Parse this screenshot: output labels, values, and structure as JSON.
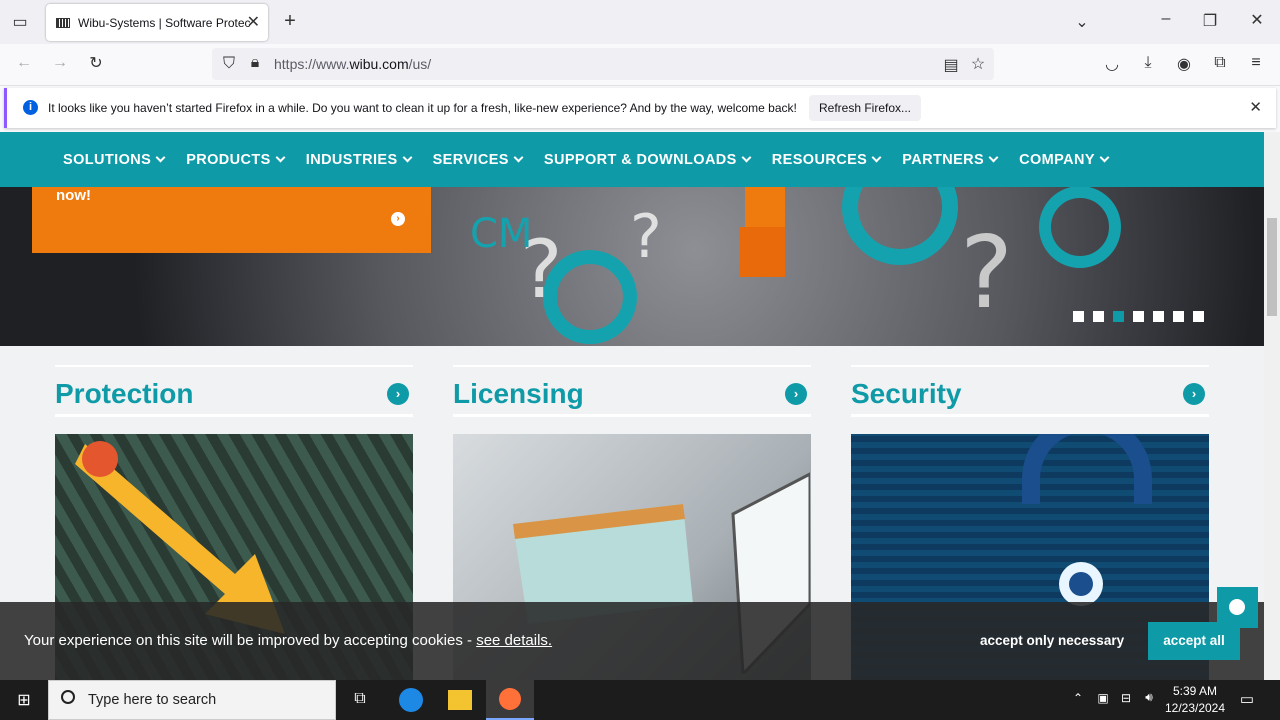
{
  "browser": {
    "tab_title": "Wibu-Systems | Software Protec",
    "url_prefix": "https://www.",
    "url_domain": "wibu.com",
    "url_path": "/us/",
    "notification": "It looks like you haven’t started Firefox in a while. Do you want to clean it up for a fresh, like-new experience? And by the way, welcome back!",
    "refresh_label": "Refresh Firefox..."
  },
  "site": {
    "nav": [
      "SOLUTIONS",
      "PRODUCTS",
      "INDUSTRIES",
      "SERVICES",
      "SUPPORT & DOWNLOADS",
      "RESOURCES",
      "PARTNERS",
      "COMPANY"
    ],
    "hero_text": "now!",
    "slider_active_index": 2,
    "slider_count": 7,
    "cards": [
      {
        "title": "Protection"
      },
      {
        "title": "Licensing"
      },
      {
        "title": "Security"
      }
    ],
    "cookie_text": "Your experience on this site will be improved by accepting cookies - ",
    "cookie_link": "see details.",
    "accept_necessary": "accept only necessary",
    "accept_all": "accept all"
  },
  "taskbar": {
    "search_placeholder": "Type here to search",
    "time": "5:39 AM",
    "date": "12/23/2024"
  },
  "colors": {
    "teal": "#0e9aa7",
    "orange": "#ef7a0e"
  }
}
